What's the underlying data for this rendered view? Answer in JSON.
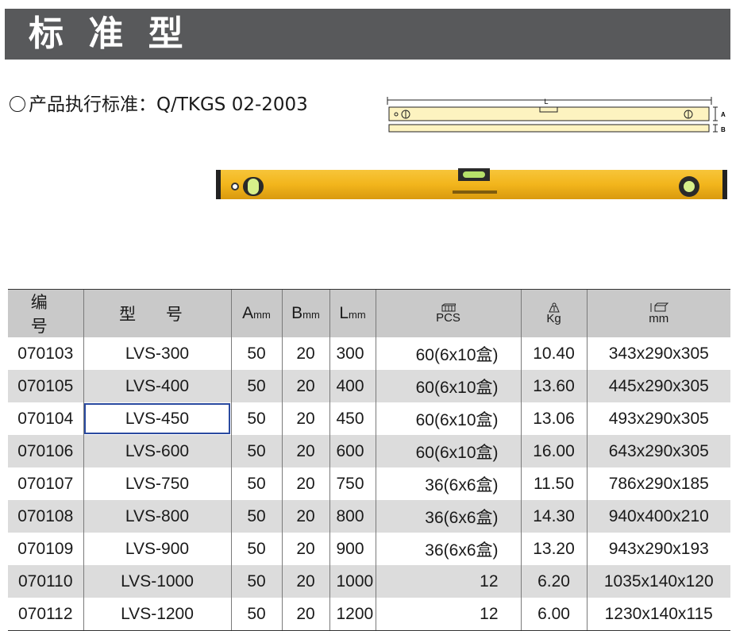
{
  "banner": {
    "title": "标 准 型"
  },
  "standard": {
    "text": "产品执行标准：Q/TKGS 02-2003"
  },
  "drawing": {
    "label_L": "L",
    "label_A": "A",
    "label_B": "B"
  },
  "colors": {
    "banner_bg": "#58595b",
    "header_bg": "#c9c9c9",
    "alt_row_bg": "#dcdcdc",
    "level_yellow": "#f2b51c",
    "selection": "#2a4aa0"
  },
  "table": {
    "headers": {
      "code": "编 号",
      "model": "型 号",
      "a": "A",
      "a_unit": "mm",
      "b": "B",
      "b_unit": "mm",
      "l": "L",
      "l_unit": "mm",
      "pcs": "PCS",
      "pcs_icon": "box-stack-icon",
      "kg": "Kg",
      "kg_icon": "weight-icon",
      "mm": "mm",
      "mm_icon": "carton-dimension-icon"
    },
    "rows": [
      {
        "code": "070103",
        "model": "LVS-300",
        "a": "50",
        "b": "20",
        "l": "300",
        "pcs": "60(6x10盒)",
        "kg": "10.40",
        "size": "343x290x305"
      },
      {
        "code": "070105",
        "model": "LVS-400",
        "a": "50",
        "b": "20",
        "l": "400",
        "pcs": "60(6x10盒)",
        "kg": "13.60",
        "size": "445x290x305"
      },
      {
        "code": "070104",
        "model": "LVS-450",
        "a": "50",
        "b": "20",
        "l": "450",
        "pcs": "60(6x10盒)",
        "kg": "13.06",
        "size": "493x290x305"
      },
      {
        "code": "070106",
        "model": "LVS-600",
        "a": "50",
        "b": "20",
        "l": "600",
        "pcs": "60(6x10盒)",
        "kg": "16.00",
        "size": "643x290x305"
      },
      {
        "code": "070107",
        "model": "LVS-750",
        "a": "50",
        "b": "20",
        "l": "750",
        "pcs": "36(6x6盒)",
        "kg": "11.50",
        "size": "786x290x185"
      },
      {
        "code": "070108",
        "model": "LVS-800",
        "a": "50",
        "b": "20",
        "l": "800",
        "pcs": "36(6x6盒)",
        "kg": "14.30",
        "size": "940x400x210"
      },
      {
        "code": "070109",
        "model": "LVS-900",
        "a": "50",
        "b": "20",
        "l": "900",
        "pcs": "36(6x6盒)",
        "kg": "13.20",
        "size": "943x290x193"
      },
      {
        "code": "070110",
        "model": "LVS-1000",
        "a": "50",
        "b": "20",
        "l": "1000",
        "pcs": "12",
        "kg": "6.20",
        "size": "1035x140x120"
      },
      {
        "code": "070112",
        "model": "LVS-1200",
        "a": "50",
        "b": "20",
        "l": "1200",
        "pcs": "12",
        "kg": "6.00",
        "size": "1230x140x115"
      }
    ]
  }
}
